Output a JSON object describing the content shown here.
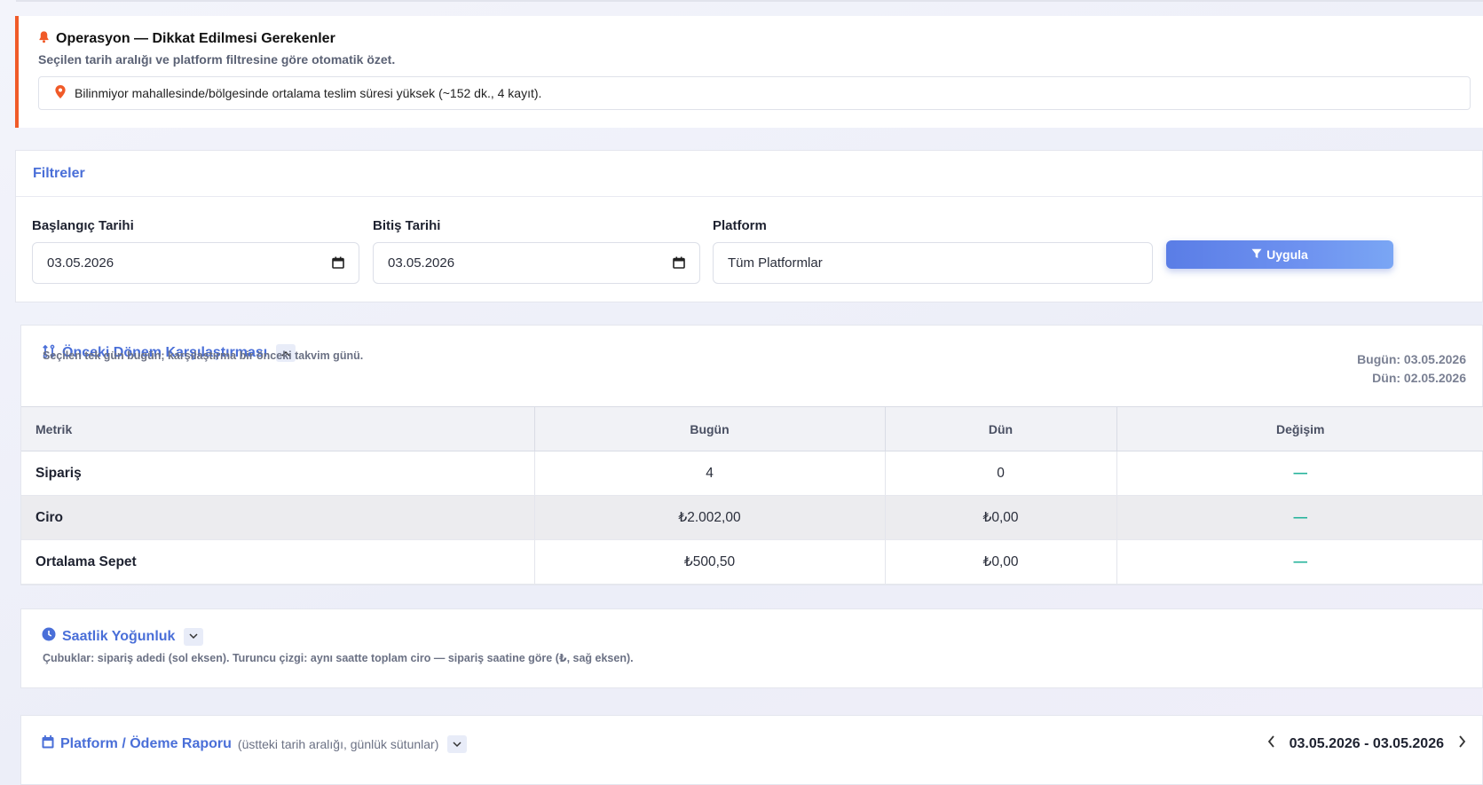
{
  "alert": {
    "title": "Operasyon — Dikkat Edilmesi Gerekenler",
    "subtitle": "Seçilen tarih aralığı ve platform filtresine göre otomatik özet.",
    "items": [
      {
        "icon": "map-pin-icon",
        "text": "Bilinmiyor mahallesinde/bölgesinde ortalama teslim süresi yüksek (~152 dk., 4 kayıt)."
      }
    ],
    "accent_color": "#f05a28"
  },
  "filters": {
    "title": "Filtreler",
    "start_label": "Başlangıç Tarihi",
    "start_value": "03.05.2026",
    "end_label": "Bitiş Tarihi",
    "end_value": "03.05.2026",
    "platform_label": "Platform",
    "platform_value": "Tüm Platformlar",
    "apply_label": "Uygula"
  },
  "compare": {
    "title": "Önceki Dönem Karşılaştırması",
    "subtitle": "Seçilen tek gün bugün; karşılaştırma bir önceki takvim günü.",
    "today_line": "Bugün: 03.05.2026",
    "yesterday_line": "Dün: 02.05.2026",
    "columns": [
      "Metrik",
      "Bugün",
      "Dün",
      "Değişim"
    ],
    "rows": [
      {
        "metric": "Sipariş",
        "today": "4",
        "yesterday": "0",
        "change": "—"
      },
      {
        "metric": "Ciro",
        "today": "₺2.002,00",
        "yesterday": "₺0,00",
        "change": "—"
      },
      {
        "metric": "Ortalama Sepet",
        "today": "₺500,50",
        "yesterday": "₺0,00",
        "change": "—"
      }
    ]
  },
  "hourly": {
    "title": "Saatlik Yoğunluk",
    "subtitle": "Çubuklar: sipariş adedi (sol eksen). Turuncu çizgi: aynı saatte toplam ciro — sipariş saatine göre (₺, sağ eksen)."
  },
  "report": {
    "title": "Platform / Ödeme Raporu",
    "note": "(üstteki tarih aralığı, günlük sütunlar)",
    "range": "03.05.2026 - 03.05.2026"
  },
  "colors": {
    "brand": "#4a6fd8",
    "positive": "#22b29a"
  }
}
